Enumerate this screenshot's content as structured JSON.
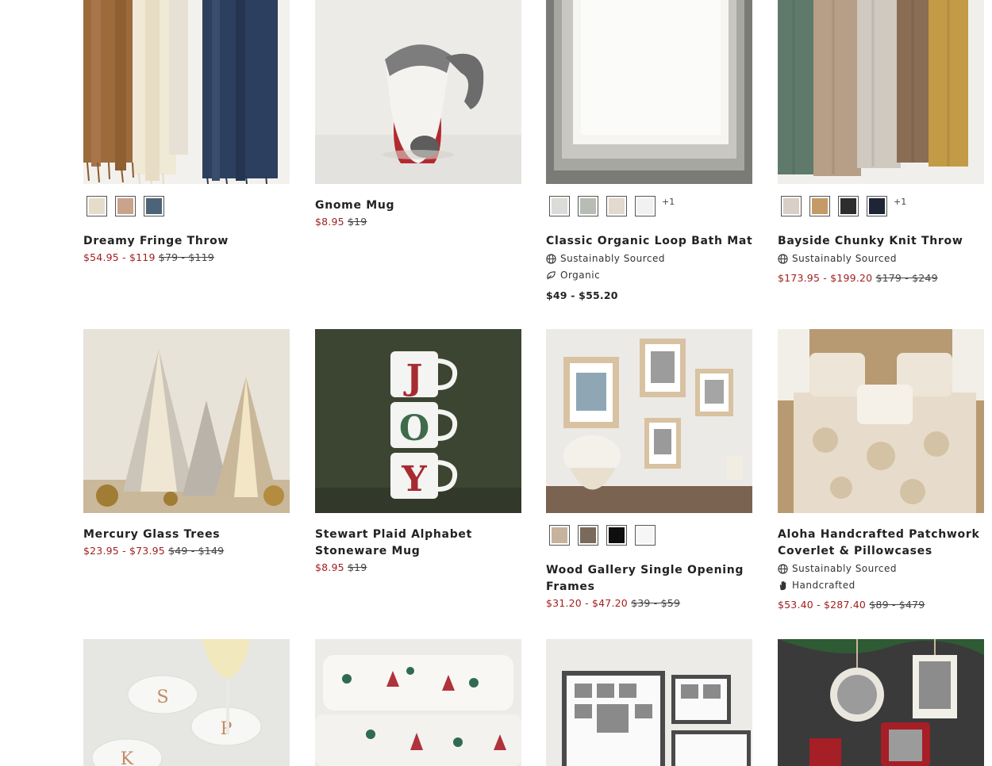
{
  "products": [
    {
      "id": "dreamy",
      "name": "Dreamy Fringe Throw",
      "sale": "$54.95 - $119",
      "orig": "$79 - $119",
      "swatch_colors": [
        "#e6dccb",
        "#c9a38c",
        "#4d6478"
      ]
    },
    {
      "id": "gnome",
      "name": "Gnome Mug",
      "sale": "$8.95",
      "orig": "$19"
    },
    {
      "id": "bathmat",
      "name": "Classic Organic Loop Bath Mat",
      "price": "$49 - $55.20",
      "swatch_colors": [
        "#dadcd8",
        "#b7bdb2",
        "#e3d9cc",
        "#f1f1f1"
      ],
      "more": "+1",
      "attributes": [
        {
          "icon": "globe-icon",
          "label": "Sustainably Sourced"
        },
        {
          "icon": "leaf-icon",
          "label": "Organic"
        }
      ]
    },
    {
      "id": "bayside",
      "name": "Bayside Chunky Knit Throw",
      "sale": "$173.95 - $199.20",
      "orig": "$179 - $249",
      "swatch_colors": [
        "#d9cfc6",
        "#c59a66",
        "#2d2d2d",
        "#1d2536"
      ],
      "more": "+1",
      "attributes": [
        {
          "icon": "globe-icon",
          "label": "Sustainably Sourced"
        }
      ]
    },
    {
      "id": "mercury",
      "name": "Mercury Glass Trees",
      "sale": "$23.95 - $73.95",
      "orig": "$49 - $149"
    },
    {
      "id": "stewart",
      "name": "Stewart Plaid Alphabet Stoneware Mug",
      "sale": "$8.95",
      "orig": "$19"
    },
    {
      "id": "wood",
      "name": "Wood Gallery Single Opening Frames",
      "sale": "$31.20 - $47.20",
      "orig": "$39 - $59",
      "swatch_colors": [
        "#c7b29d",
        "#7a6a5c",
        "#0e0e0e",
        "#f6f6f6"
      ]
    },
    {
      "id": "aloha",
      "name": "Aloha Handcrafted Patchwork Coverlet & Pillowcases",
      "sale": "$53.40 - $287.40",
      "orig": "$89 - $479",
      "attributes": [
        {
          "icon": "globe-icon",
          "label": "Sustainably Sourced"
        },
        {
          "icon": "hand-icon",
          "label": "Handcrafted"
        }
      ]
    }
  ],
  "mug_letters": [
    "J",
    "O",
    "Y"
  ],
  "coaster_letters": [
    "S",
    "P",
    "K"
  ],
  "colors": {
    "sale": "#a31f1f",
    "text": "#222222"
  }
}
